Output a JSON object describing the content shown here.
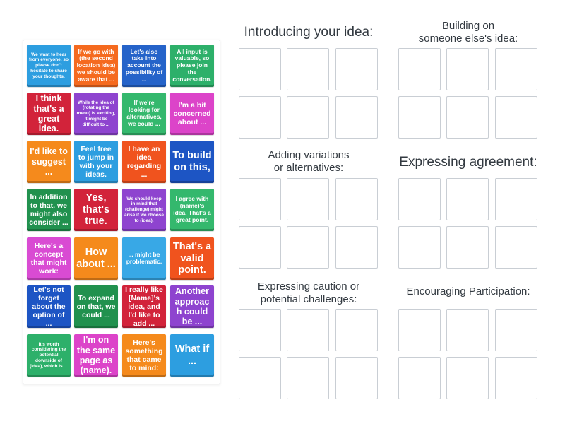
{
  "cards": [
    {
      "text": "We want to hear from everyone, so please don't hesitate to share your thoughts.",
      "color": "#2d9ee0",
      "size": "xs"
    },
    {
      "text": "If we go with (the second location idea) we should be aware that ...",
      "color": "#f56a1f",
      "size": "s"
    },
    {
      "text": "Let's also take into account the possibility of ...",
      "color": "#2563c9",
      "size": "s"
    },
    {
      "text": "All input is valuable, so please join the conversation.",
      "color": "#2db06a",
      "size": "s"
    },
    {
      "text": "I think that's a great idea.",
      "color": "#d2233a",
      "size": "l"
    },
    {
      "text": "While the idea of (rotating the menu) is exciting, it might be difficult to ...",
      "color": "#8e44cf",
      "size": "xs"
    },
    {
      "text": "If we're looking for alternatives, we could ...",
      "color": "#34b86d",
      "size": "s"
    },
    {
      "text": "I'm a bit concerned about ...",
      "color": "#dc44c9",
      "size": "m"
    },
    {
      "text": "I'd like to suggest ...",
      "color": "#f58a1c",
      "size": "l"
    },
    {
      "text": "Feel free to jump in with your ideas.",
      "color": "#2d9ee0",
      "size": "m"
    },
    {
      "text": "I have an idea regarding ...",
      "color": "#f0531e",
      "size": "m"
    },
    {
      "text": "To build on this,",
      "color": "#1d55c4",
      "size": "xl"
    },
    {
      "text": "In addition to that, we might also consider ...",
      "color": "#21914e",
      "size": "m"
    },
    {
      "text": "Yes, that's true.",
      "color": "#d2233a",
      "size": "xl"
    },
    {
      "text": "We should keep in mind that (challenge) might arise if we choose to (idea).",
      "color": "#8e44cf",
      "size": "xs"
    },
    {
      "text": "I agree with (name)'s idea. That's a great point.",
      "color": "#34b86d",
      "size": "s"
    },
    {
      "text": "Here's a concept that might work:",
      "color": "#d94bd3",
      "size": "m"
    },
    {
      "text": "How about ...",
      "color": "#f58a1c",
      "size": "xl"
    },
    {
      "text": "... might be problematic.",
      "color": "#38a8e6",
      "size": "s"
    },
    {
      "text": "That's a valid point.",
      "color": "#f0531e",
      "size": "xl"
    },
    {
      "text": "Let's not forget about the option of ...",
      "color": "#1d55c4",
      "size": "m"
    },
    {
      "text": "To expand on that, we could ...",
      "color": "#21914e",
      "size": "m"
    },
    {
      "text": "I really like [Name]'s idea, and I'd like to add ...",
      "color": "#d2233a",
      "size": "m"
    },
    {
      "text": "Another approach could be ...",
      "color": "#8e44cf",
      "size": "l"
    },
    {
      "text": "It's worth considering the potential downside of (idea), which is ...",
      "color": "#2db06a",
      "size": "xs"
    },
    {
      "text": "I'm on the same page as (name).",
      "color": "#dc44c9",
      "size": "l"
    },
    {
      "text": "Here's something that came to mind:",
      "color": "#f58a1c",
      "size": "m"
    },
    {
      "text": "What if ...",
      "color": "#2d9ee0",
      "size": "xl"
    }
  ],
  "groups": [
    {
      "title": "Introducing your idea:"
    },
    {
      "title": "Building on\nsomeone else's idea:"
    },
    {
      "title": "Adding variations\nor alternatives:"
    },
    {
      "title": "Expressing agreement:"
    },
    {
      "title": "Expressing caution or\npotential challenges:"
    },
    {
      "title": "Encouraging Participation:"
    }
  ]
}
